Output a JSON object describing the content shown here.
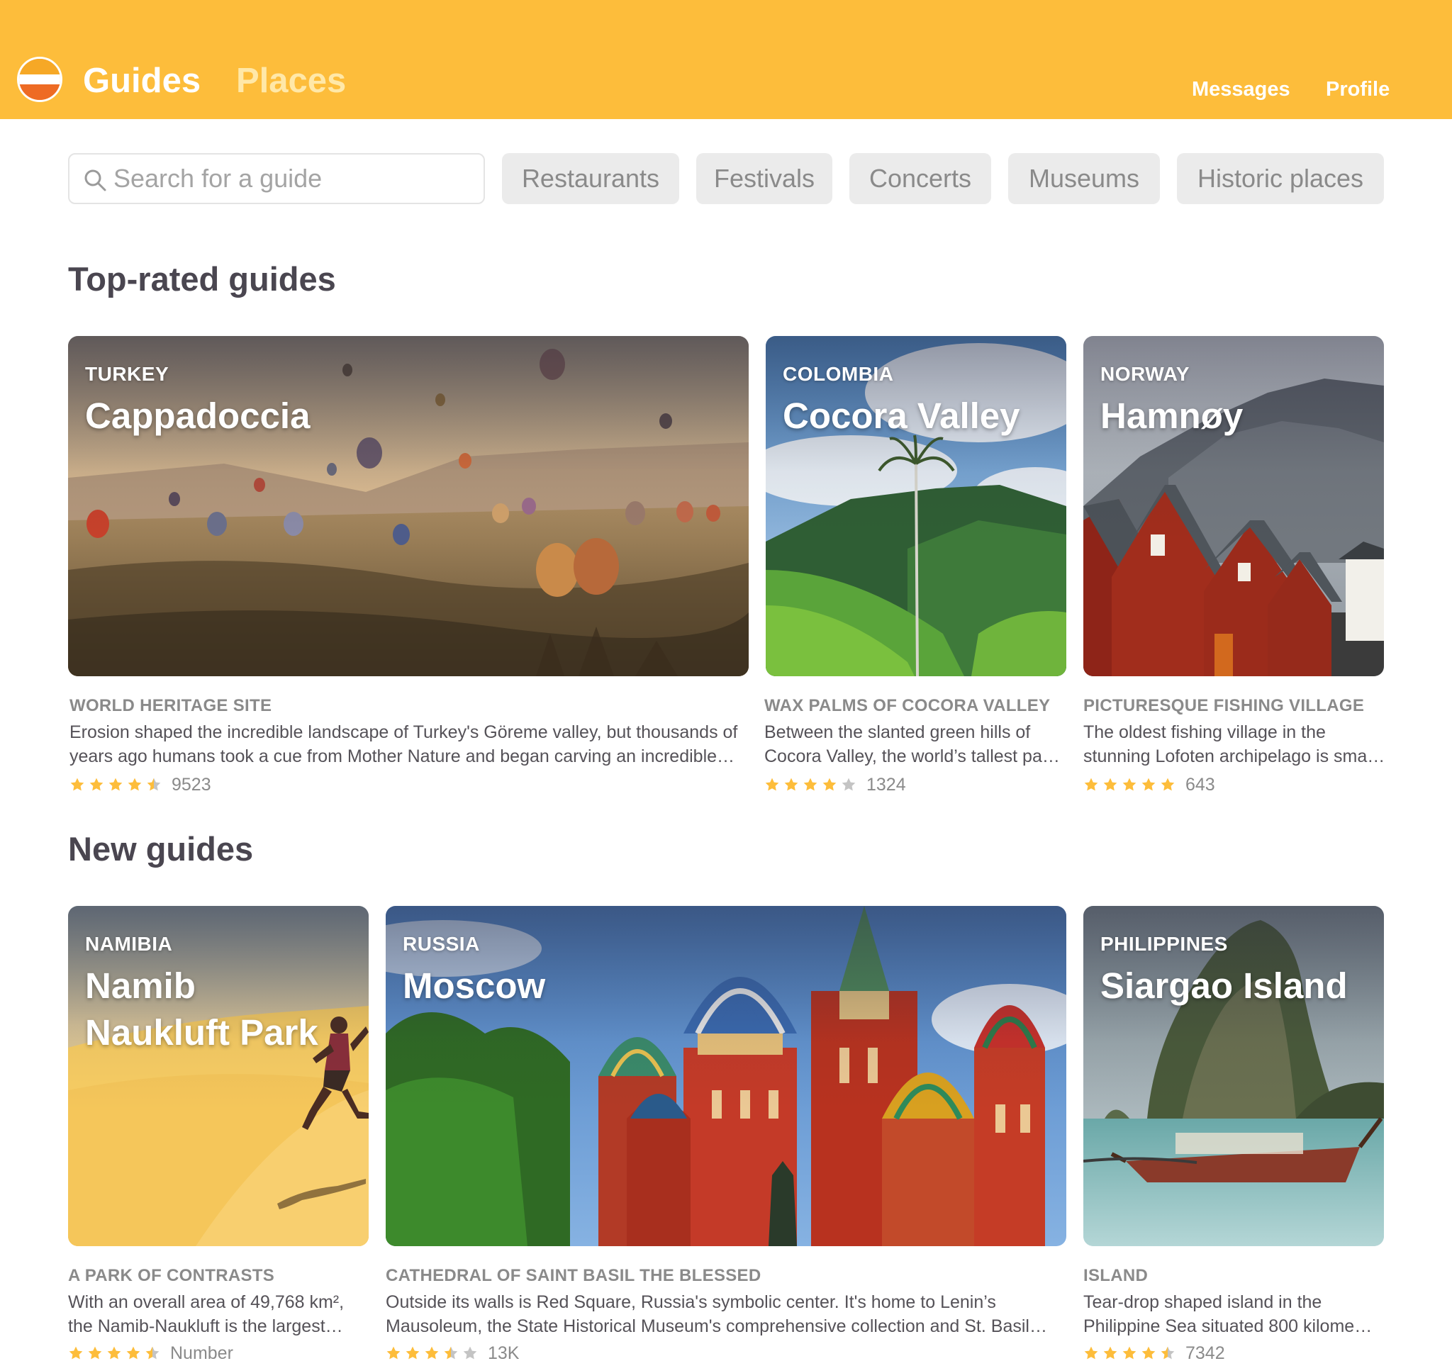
{
  "header": {
    "nav_guides": "Guides",
    "nav_places": "Places",
    "nav_messages": "Messages",
    "nav_profile": "Profile"
  },
  "search": {
    "placeholder": "Search for a guide",
    "value": ""
  },
  "filters": [
    "Restaurants",
    "Festivals",
    "Concerts",
    "Museums",
    "Historic places"
  ],
  "sections": {
    "top_rated": {
      "title": "Top-rated guides",
      "cards": [
        {
          "country": "TURKEY",
          "name": "Cappadoccia",
          "subtitle": "WORLD HERITAGE SITE",
          "desc_line1": "Erosion shaped the incredible landscape of Turkey's Göreme valley, but thousands of",
          "desc_line2": "years ago humans took a cue from Mother Nature and began carving an incredible…",
          "rating": 4.5,
          "count": "9523"
        },
        {
          "country": "COLOMBIA",
          "name": "Cocora Valley",
          "subtitle": "WAX PALMS OF COCORA VALLEY",
          "desc_line1": "Between the slanted green hills of",
          "desc_line2": "Cocora Valley, the world’s tallest pa…",
          "rating": 4,
          "count": "1324"
        },
        {
          "country": "NORWAY",
          "name": "Hamnøy",
          "subtitle": "PICTURESQUE FISHING VILLAGE",
          "desc_line1": "The oldest fishing village in the",
          "desc_line2": "stunning Lofoten archipelago is sma…",
          "rating": 5,
          "count": "643"
        }
      ]
    },
    "new_guides": {
      "title": "New guides",
      "cards": [
        {
          "country": "NAMIBIA",
          "name": "Namib Naukluft Park",
          "subtitle": "A PARK OF CONTRASTS",
          "desc_line1": "With an overall area of 49,768 km²,",
          "desc_line2": "the Namib-Naukluft is the largest…",
          "rating": 4.5,
          "count": "Number"
        },
        {
          "country": "RUSSIA",
          "name": "Moscow",
          "subtitle": "CATHEDRAL OF SAINT BASIL THE BLESSED",
          "desc_line1": "Outside its walls is Red Square, Russia's symbolic center. It's home to Lenin’s",
          "desc_line2": "Mausoleum, the State Historical Museum's comprehensive collection and St. Basil…",
          "rating": 3.5,
          "count": "13K"
        },
        {
          "country": "PHILIPPINES",
          "name": "Siargao Island",
          "subtitle": "ISLAND",
          "desc_line1": "Tear-drop shaped island in the",
          "desc_line2": "Philippine Sea situated 800 kilome…",
          "rating": 4.5,
          "count": "7342"
        }
      ]
    }
  },
  "colors": {
    "header_bg": "#fdbd3b",
    "star_filled": "#fdbd3b",
    "star_empty": "#c4c4c4",
    "text_dark": "#4a4650",
    "text_muted": "#8a8a8a"
  }
}
